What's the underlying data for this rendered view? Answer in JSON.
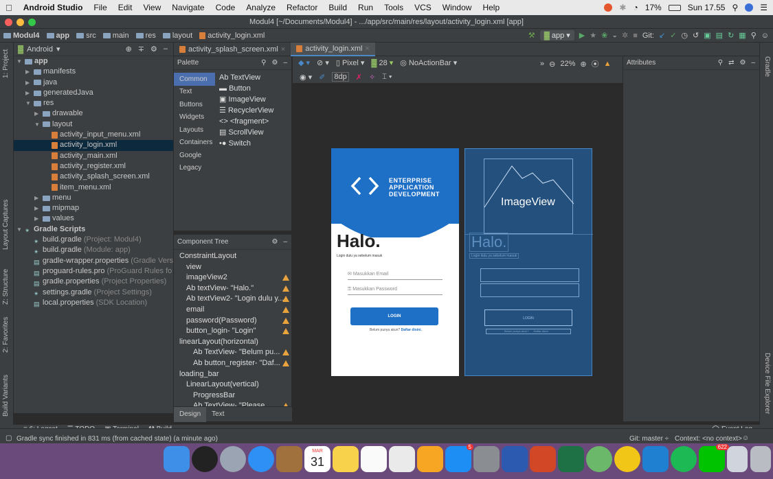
{
  "menubar": {
    "apple_icon": "apple-icon",
    "app_name": "Android Studio",
    "menus": [
      "File",
      "Edit",
      "View",
      "Navigate",
      "Code",
      "Analyze",
      "Refactor",
      "Build",
      "Run",
      "Tools",
      "VCS",
      "Window",
      "Help"
    ],
    "battery": "17%",
    "clock": "Sun 17.55"
  },
  "window": {
    "title": "Modul4 [~/Documents/Modul4] - .../app/src/main/res/layout/activity_login.xml [app]"
  },
  "navbar": {
    "crumbs": [
      "Modul4",
      "app",
      "src",
      "main",
      "res",
      "layout",
      "activity_login.xml"
    ],
    "run_config": "app",
    "git_label": "Git:"
  },
  "project_panel": {
    "title": "Android",
    "side_labels": [
      "1: Project",
      "Layout Captures",
      "Z: Structure",
      "2: Favorites",
      "Build Variants"
    ],
    "tree": [
      {
        "label": "app",
        "indent": 0,
        "arrow": "▼",
        "icon": "folder"
      },
      {
        "label": "manifests",
        "indent": 1,
        "arrow": "▶",
        "icon": "folder"
      },
      {
        "label": "java",
        "indent": 1,
        "arrow": "▶",
        "icon": "folder"
      },
      {
        "label": "generatedJava",
        "indent": 1,
        "arrow": "▶",
        "icon": "folder"
      },
      {
        "label": "res",
        "indent": 1,
        "arrow": "▼",
        "icon": "folder"
      },
      {
        "label": "drawable",
        "indent": 2,
        "arrow": "▶",
        "icon": "folder"
      },
      {
        "label": "layout",
        "indent": 2,
        "arrow": "▼",
        "icon": "folder"
      },
      {
        "label": "activity_input_menu.xml",
        "indent": 3,
        "arrow": "",
        "icon": "xml"
      },
      {
        "label": "activity_login.xml",
        "indent": 3,
        "arrow": "",
        "icon": "xml",
        "selected": true
      },
      {
        "label": "activity_main.xml",
        "indent": 3,
        "arrow": "",
        "icon": "xml"
      },
      {
        "label": "activity_register.xml",
        "indent": 3,
        "arrow": "",
        "icon": "xml"
      },
      {
        "label": "activity_splash_screen.xml",
        "indent": 3,
        "arrow": "",
        "icon": "xml"
      },
      {
        "label": "item_menu.xml",
        "indent": 3,
        "arrow": "",
        "icon": "xml"
      },
      {
        "label": "menu",
        "indent": 2,
        "arrow": "▶",
        "icon": "folder"
      },
      {
        "label": "mipmap",
        "indent": 2,
        "arrow": "▶",
        "icon": "folder"
      },
      {
        "label": "values",
        "indent": 2,
        "arrow": "▶",
        "icon": "folder"
      },
      {
        "label": "Gradle Scripts",
        "indent": 0,
        "arrow": "▼",
        "icon": "gradle"
      },
      {
        "label": "build.gradle",
        "note": "(Project: Modul4)",
        "indent": 1,
        "arrow": "",
        "icon": "gradle"
      },
      {
        "label": "build.gradle",
        "note": "(Module: app)",
        "indent": 1,
        "arrow": "",
        "icon": "gradle"
      },
      {
        "label": "gradle-wrapper.properties",
        "note": "(Gradle Vers",
        "indent": 1,
        "arrow": "",
        "icon": "props"
      },
      {
        "label": "proguard-rules.pro",
        "note": "(ProGuard Rules fo",
        "indent": 1,
        "arrow": "",
        "icon": "props"
      },
      {
        "label": "gradle.properties",
        "note": "(Project Properties)",
        "indent": 1,
        "arrow": "",
        "icon": "props"
      },
      {
        "label": "settings.gradle",
        "note": "(Project Settings)",
        "indent": 1,
        "arrow": "",
        "icon": "gradle"
      },
      {
        "label": "local.properties",
        "note": "(SDK Location)",
        "indent": 1,
        "arrow": "",
        "icon": "props"
      }
    ]
  },
  "editor_tabs": [
    "activity_splash_screen.xml",
    "activity_login.xml"
  ],
  "palette": {
    "title": "Palette",
    "categories": [
      "Common",
      "Text",
      "Buttons",
      "Widgets",
      "Layouts",
      "Containers",
      "Google",
      "Legacy"
    ],
    "items": [
      "Ab TextView",
      "Button",
      "ImageView",
      "RecyclerView",
      "<> <fragment>",
      "ScrollView",
      "Switch"
    ]
  },
  "design_toolbar": {
    "device": "Pixel",
    "api": "28",
    "theme": "NoActionBar",
    "zoom": "22%",
    "margin": "8dp"
  },
  "component_tree": {
    "title": "Component Tree",
    "rows": [
      {
        "label": "ConstraintLayout",
        "indent": 0,
        "warn": false
      },
      {
        "label": "view",
        "indent": 1,
        "warn": false
      },
      {
        "label": "imageView2",
        "indent": 1,
        "warn": true
      },
      {
        "label": "Ab textView- \"Halo.\"",
        "indent": 1,
        "warn": true
      },
      {
        "label": "Ab textView2- \"Login dulu y...",
        "indent": 1,
        "warn": true
      },
      {
        "label": "email",
        "indent": 1,
        "warn": true
      },
      {
        "label": "password(Password)",
        "indent": 1,
        "warn": true
      },
      {
        "label": "button_login- \"Login\"",
        "indent": 1,
        "warn": true
      },
      {
        "label": "linearLayout(horizontal)",
        "indent": 0,
        "warn": false
      },
      {
        "label": "Ab TextView- \"Belum pu...",
        "indent": 2,
        "warn": true
      },
      {
        "label": "Ab button_register- \"Daf...",
        "indent": 2,
        "warn": true
      },
      {
        "label": "loading_bar",
        "indent": 0,
        "warn": false
      },
      {
        "label": "LinearLayout(vertical)",
        "indent": 1,
        "warn": false
      },
      {
        "label": "ProgressBar",
        "indent": 2,
        "warn": false
      },
      {
        "label": "Ab TextView- \"Please ...",
        "indent": 2,
        "warn": true
      }
    ]
  },
  "design_tabs": [
    "Design",
    "Text"
  ],
  "attributes": {
    "title": "Attributes"
  },
  "preview": {
    "logo_line1": "ENTERPRISE",
    "logo_line2": "APPLICATION",
    "logo_line3": "DEVELOPMENT",
    "heading": "Halo.",
    "subtitle": "Login dulu ya sebelum masuk",
    "email_placeholder": "Masukkan Email",
    "password_placeholder": "Masukkan Password",
    "login_button": "LOGIN",
    "register_prompt": "Belum punya akun?",
    "register_link": "Daftar disini.",
    "blueprint_imageview": "ImageView",
    "blueprint_heading": "Halo.",
    "blueprint_subtitle": "Login dulu ya sebelum masuk",
    "blueprint_login": "LOGIN",
    "blueprint_prompt": "Belum punya akun?",
    "blueprint_link": "Daftar disini"
  },
  "right_strip": [
    "Gradle",
    "Device File Explorer"
  ],
  "bottom_tabs": [
    "6: Logcat",
    "TODO",
    "Terminal",
    "Build"
  ],
  "event_log": "Event Log",
  "status": {
    "message": "Gradle sync finished in 831 ms (from cached state) (a minute ago)",
    "git_branch": "Git: master ÷",
    "context": "Context: <no context>"
  },
  "dock": {
    "calendar_month": "MAR",
    "calendar_day": "31",
    "badge_1": "5",
    "badge_2": "622"
  }
}
